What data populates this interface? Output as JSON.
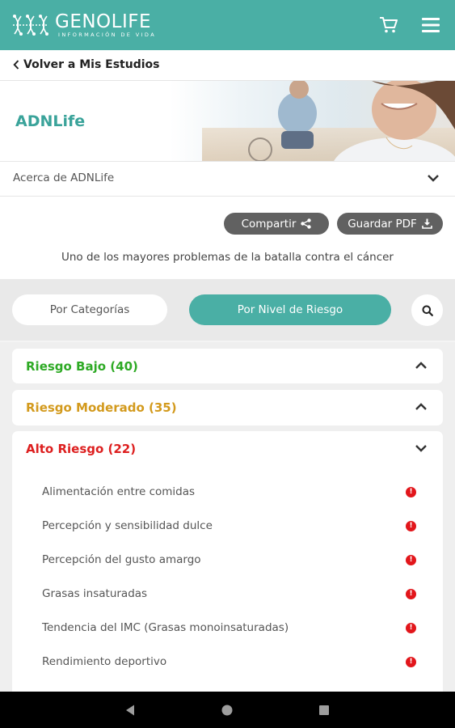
{
  "header": {
    "brand": "GENOLIFE",
    "tagline": "INFORMACIÓN DE VIDA",
    "icons": [
      "dna-logo-icon",
      "cart-icon",
      "menu-icon"
    ],
    "accent_color": "#4aafa5"
  },
  "back": {
    "label": "Volver a Mis Estudios",
    "icon": "chevron-left-icon"
  },
  "hero": {
    "title": "ADNLife"
  },
  "about": {
    "label": "Acerca de ADNLife",
    "icon": "chevron-down-icon"
  },
  "actions": {
    "share_label": "Compartir",
    "share_icon": "share-icon",
    "pdf_label": "Guardar PDF",
    "pdf_icon": "download-icon",
    "intro": "Uno de los mayores problemas de la batalla contra el cáncer"
  },
  "filters": {
    "tabs": [
      {
        "label": "Por Categorías",
        "active": false
      },
      {
        "label": "Por Nivel de Riesgo",
        "active": true
      }
    ],
    "search_icon": "search-icon"
  },
  "groups": [
    {
      "title": "Riesgo Bajo (40)",
      "color": "#2eaa25",
      "expanded": false
    },
    {
      "title": "Riesgo Moderado (35)",
      "color": "#d39a1d",
      "expanded": false
    },
    {
      "title": "Alto Riesgo (22)",
      "color": "#dd1f1f",
      "expanded": true,
      "items": [
        {
          "label": "Alimentación entre comidas"
        },
        {
          "label": "Percepción y sensibilidad dulce"
        },
        {
          "label": "Percepción del gusto amargo"
        },
        {
          "label": "Grasas insaturadas"
        },
        {
          "label": "Tendencia del IMC (Grasas monoinsaturadas)"
        },
        {
          "label": "Rendimiento deportivo"
        }
      ]
    }
  ],
  "system_nav": [
    "nav-back-icon",
    "nav-home-icon",
    "nav-recents-icon"
  ]
}
